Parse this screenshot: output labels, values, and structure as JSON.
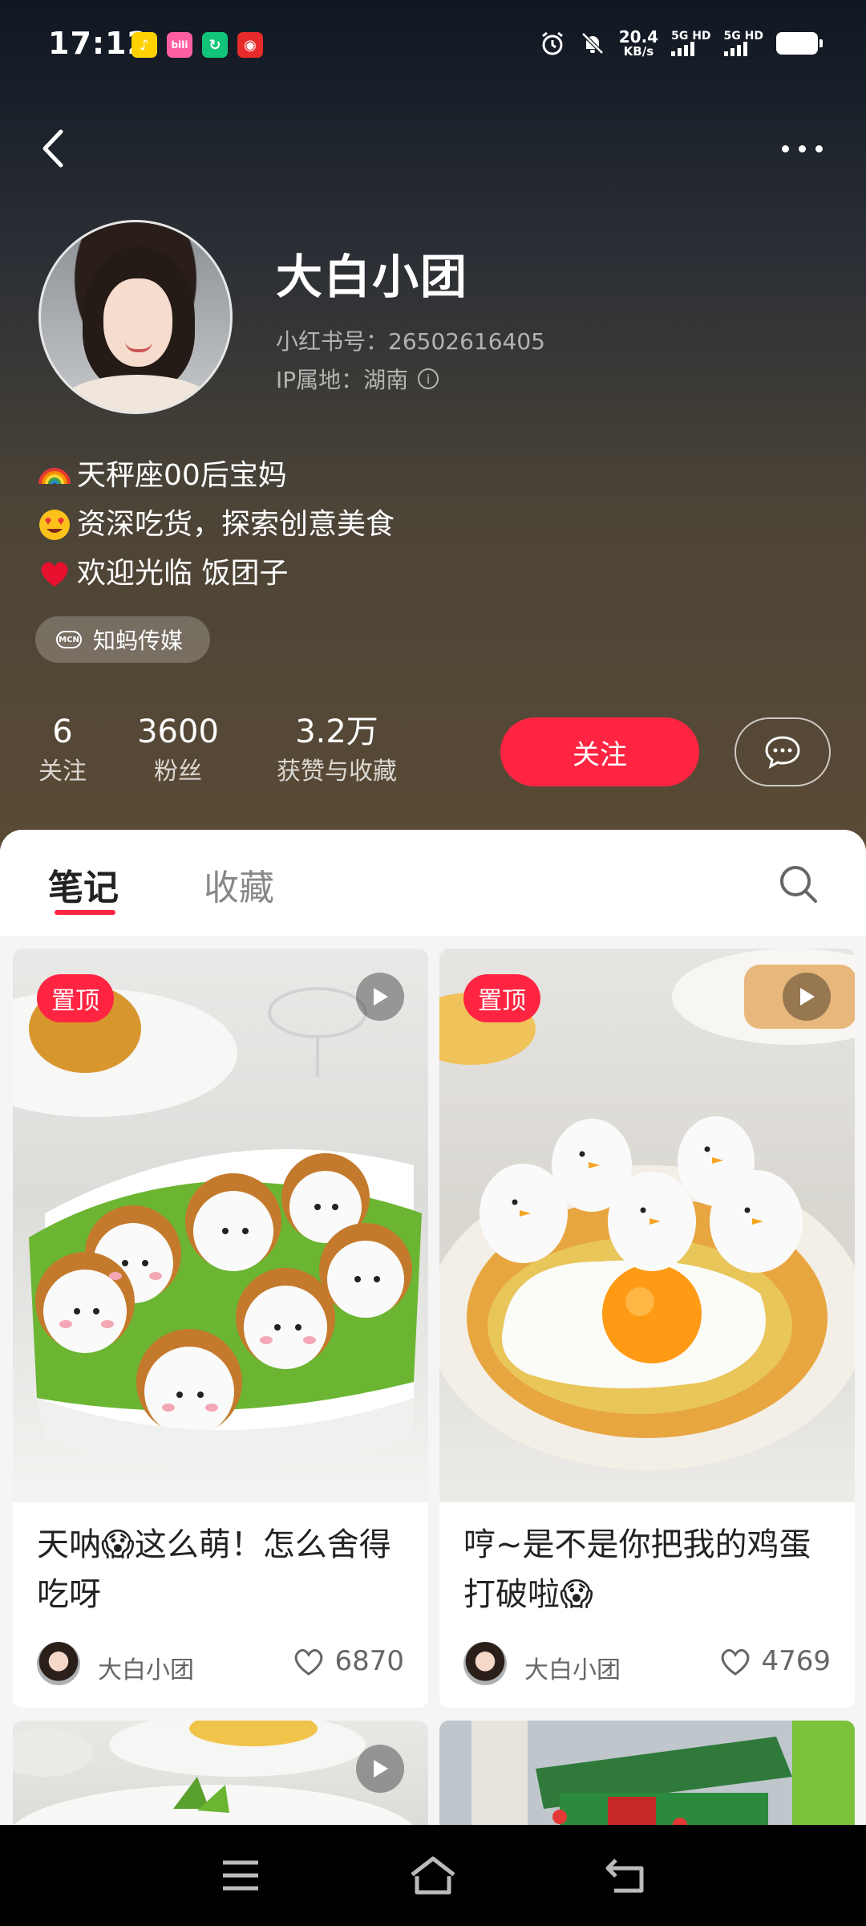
{
  "status_bar": {
    "time": "17:12",
    "net_speed_value": "20.4",
    "net_speed_unit": "KB/s",
    "sim1": "5G HD",
    "sim2": "5G HD"
  },
  "profile": {
    "nickname": "大白小团",
    "red_id_label": "小红书号：26502616405",
    "ip_label": "IP属地：湖南",
    "bio": [
      {
        "emoji": "rainbow",
        "text": "天秤座00后宝妈"
      },
      {
        "emoji": "heart-eyes",
        "text": "资深吃货，探索创意美食"
      },
      {
        "emoji": "red-heart",
        "text": "欢迎光临 饭团子"
      }
    ],
    "mcn_icon_text": "MCN",
    "mcn_label": "知蚂传媒"
  },
  "stats": [
    {
      "value": "6",
      "label": "关注"
    },
    {
      "value": "3600",
      "label": "粉丝"
    },
    {
      "value": "3.2万",
      "label": "获赞与收藏"
    }
  ],
  "actions": {
    "follow_label": "关注"
  },
  "tabs": [
    {
      "label": "笔记",
      "active": true
    },
    {
      "label": "收藏",
      "active": false
    }
  ],
  "notes": [
    {
      "pin": "置顶",
      "title": "天呐😱这么萌！怎么舍得吃呀",
      "author": "大白小团",
      "likes": "6870"
    },
    {
      "pin": "置顶",
      "title": "哼~是不是你把我的鸡蛋打破啦😱",
      "author": "大白小团",
      "likes": "4769"
    }
  ],
  "colors": {
    "accent": "#ff2442",
    "header_top": "#0f1722",
    "header_bottom": "#5a4a35"
  }
}
